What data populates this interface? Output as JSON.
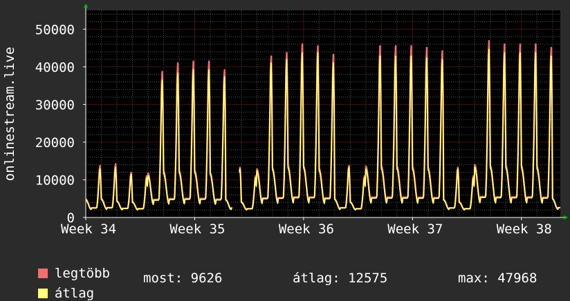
{
  "chart_data": {
    "type": "line",
    "ylabel": "onlinestream.live",
    "ylim": [
      0,
      55000
    ],
    "yticks": [
      0,
      10000,
      20000,
      30000,
      40000,
      50000
    ],
    "ytick_labels": [
      "0",
      "10000",
      "20000",
      "30000",
      "40000",
      "50000"
    ],
    "xlim": [
      0,
      30.5
    ],
    "xticks": [
      0,
      7,
      14,
      21,
      28
    ],
    "xtick_labels": [
      "Week 34",
      "Week 35",
      "Week 36",
      "Week 37",
      "Week 38"
    ],
    "grid": true,
    "colors": {
      "legtobb": "#f07070",
      "atlag": "#ffff80",
      "background": "#2b2b2b",
      "plot_background": "#000000",
      "grid_major": "#8b2020",
      "grid_minor": "#5a5a5a",
      "axis": "#ffffff"
    },
    "series": [
      {
        "name": "legtöbb",
        "color": "#f07070",
        "daily_peaks": [
          15000,
          15500,
          13000,
          12000,
          42500,
          45000,
          45500,
          45500,
          43000,
          14500,
          12000,
          47000,
          48000,
          50500,
          50000,
          47500,
          15000,
          12000,
          50000,
          50000,
          50000,
          49500,
          48500,
          14500,
          12000,
          51500,
          50500,
          50500,
          50500,
          49500,
          15500
        ]
      },
      {
        "name": "átlag",
        "color": "#ffff80",
        "daily_peaks": [
          14000,
          14500,
          12500,
          11500,
          40000,
          42000,
          43000,
          43000,
          41000,
          14000,
          11500,
          45000,
          46000,
          48000,
          48000,
          45000,
          14500,
          11500,
          47000,
          47000,
          47000,
          46500,
          46000,
          14000,
          11500,
          49000,
          48000,
          48000,
          48000,
          47000,
          15000
        ]
      }
    ],
    "gap_x": [
      9.45,
      9.85
    ]
  },
  "legend": {
    "items": [
      {
        "label": "legtöbb",
        "color": "#f07070"
      },
      {
        "label": "átlag",
        "color": "#ffff80"
      }
    ],
    "stats": {
      "most_label": "most:",
      "most_value": "9626",
      "atlag_label": "átlag:",
      "atlag_value": "12575",
      "max_label": "max:",
      "max_value": "47968"
    }
  }
}
